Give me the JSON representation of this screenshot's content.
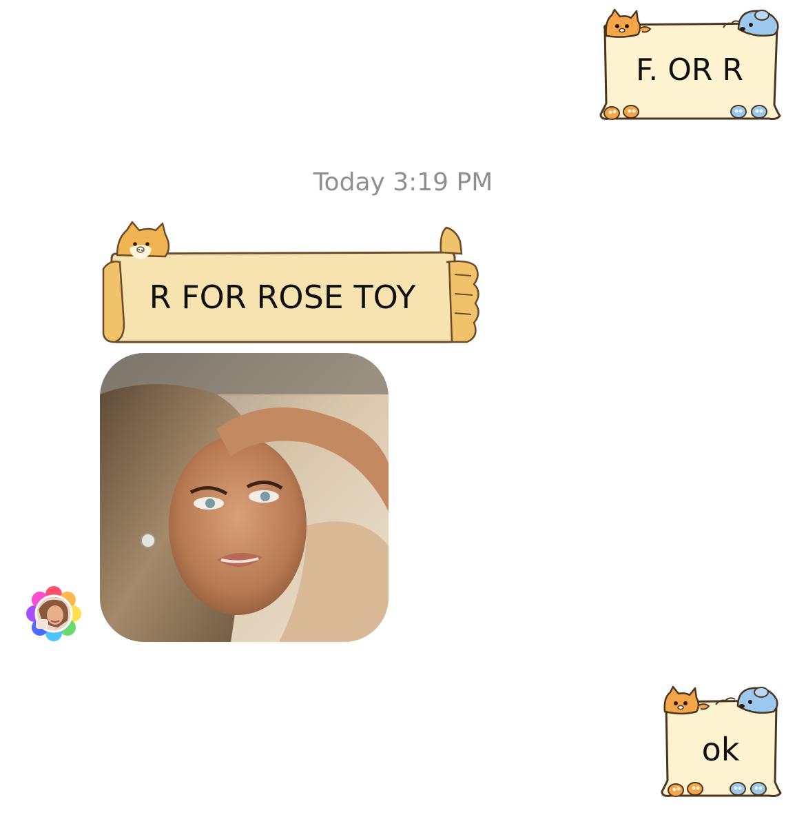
{
  "conversation": {
    "timestamp": "Today 3:19 PM",
    "messages": [
      {
        "from": "me",
        "type": "sticker-frame",
        "frame": "cat-dog",
        "text": "F. OR R"
      },
      {
        "from": "contact",
        "type": "sticker-frame",
        "frame": "shiba",
        "text": "R FOR ROSE TOY"
      },
      {
        "from": "contact",
        "type": "photo",
        "subject": "woman-portrait"
      },
      {
        "from": "me",
        "type": "sticker-frame",
        "frame": "cat-dog",
        "text": "ok"
      }
    ]
  },
  "colors": {
    "background": "#ffffff",
    "timestamp": "#8e8e93",
    "frame_fill": "#fdf3d1",
    "frame_stroke": "#6b4a2a",
    "shiba_fill": "#f6e3b0",
    "cat_orange": "#f4a54a",
    "dog_blue": "#9cc8ee"
  }
}
